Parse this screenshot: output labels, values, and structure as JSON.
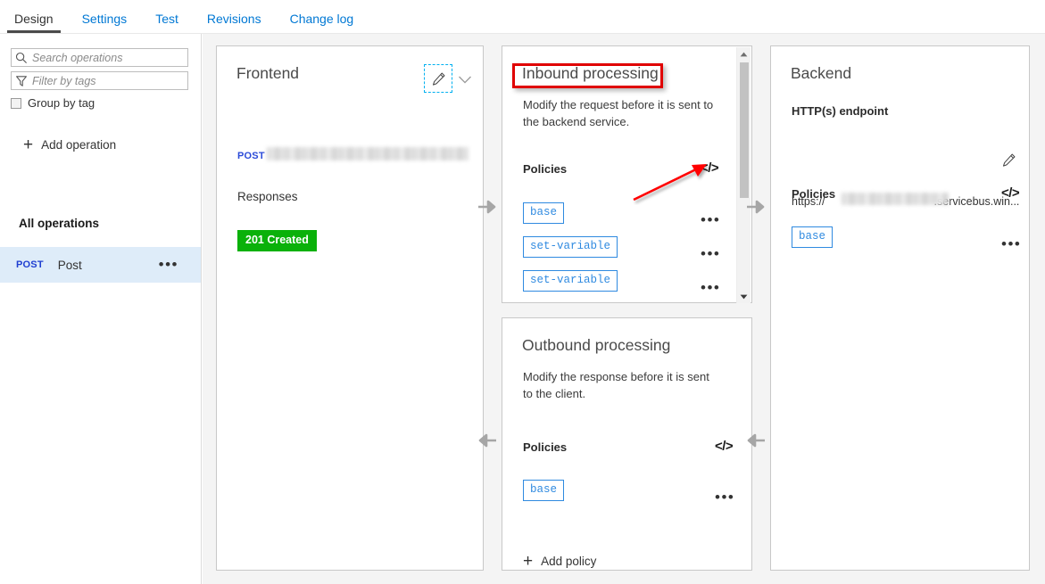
{
  "tabs": [
    {
      "label": "Design",
      "active": true
    },
    {
      "label": "Settings",
      "active": false
    },
    {
      "label": "Test",
      "active": false
    },
    {
      "label": "Revisions",
      "active": false
    },
    {
      "label": "Change log",
      "active": false
    }
  ],
  "sidebar": {
    "search_placeholder": "Search operations",
    "search_value": "",
    "filter_placeholder": "Filter by tags",
    "filter_value": "",
    "group_by_tag_label": "Group by tag",
    "group_by_tag_checked": false,
    "add_operation_label": "Add operation",
    "add_operation_plus": "+",
    "all_operations_label": "All operations",
    "operations": [
      {
        "verb": "POST",
        "name": "Post",
        "selected": true,
        "menu": "•••"
      }
    ]
  },
  "frontend": {
    "title": "Frontend",
    "verb": "POST",
    "url_redacted": true,
    "responses_label": "Responses",
    "response_badge": "201 Created",
    "edit_icon": "pencil-icon",
    "expand_icon": "chevron-down-icon"
  },
  "inbound": {
    "title": "Inbound processing",
    "description": "Modify the request before it is sent to the backend service.",
    "policies_label": "Policies",
    "code_icon": "</>",
    "policies": [
      {
        "name": "base",
        "menu": "•••"
      },
      {
        "name": "set-variable",
        "menu": "•••"
      },
      {
        "name": "set-variable",
        "menu": "•••"
      }
    ],
    "scroll": {
      "up_glyph": "▲",
      "down_glyph": "▼",
      "thumb_position_percent": 6,
      "thumb_size_percent": 55
    }
  },
  "outbound": {
    "title": "Outbound processing",
    "description": "Modify the response before it is sent to the client.",
    "policies_label": "Policies",
    "code_icon": "</>",
    "policies": [
      {
        "name": "base",
        "menu": "•••"
      }
    ],
    "add_policy_label": "Add policy",
    "add_policy_plus": "+"
  },
  "backend": {
    "title": "Backend",
    "endpoint_label": "HTTP(s) endpoint",
    "endpoint_url_prefix": "https://",
    "endpoint_url_suffix": ".servicebus.win...",
    "url_redacted": true,
    "edit_icon": "pencil-icon",
    "policies_label": "Policies",
    "code_icon": "</>",
    "policies": [
      {
        "name": "base",
        "menu": "•••"
      }
    ]
  },
  "flow": {
    "arrows": [
      {
        "name": "frontend-to-inbound",
        "direction": "right"
      },
      {
        "name": "inbound-to-backend",
        "direction": "right"
      },
      {
        "name": "backend-to-outbound",
        "direction": "left"
      },
      {
        "name": "outbound-to-frontend",
        "direction": "left"
      }
    ]
  },
  "annotations": {
    "highlight_color": "#e00000",
    "highlight_target": "Inbound processing",
    "arrow_color": "#ff0000",
    "arrow_target": "inbound-policies-code-view"
  }
}
